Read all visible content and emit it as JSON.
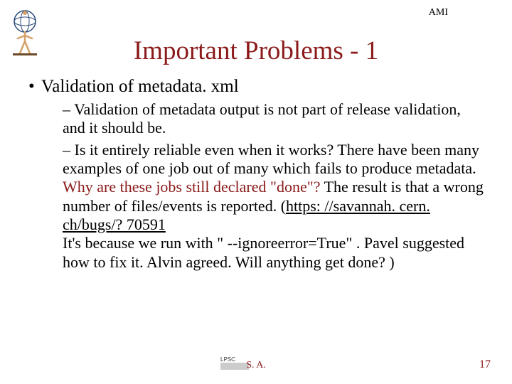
{
  "header_label": "AMI",
  "title": "Important Problems - 1",
  "bullet1": "Validation of metadata. xml",
  "sub1": "Validation of metadata output is not part of release validation, and it should be.",
  "sub2a": "Is it entirely reliable even when it works? There have been many examples of one job out of many which fails to produce metadata. ",
  "sub2_hl": "Why are these jobs still declared \"done\"?",
  "sub2b": " The result is that a wrong number of files/events is reported. (",
  "sub2_link": "https: //savannah. cern. ch/bugs/? 70591",
  "sub2_linebreak": "",
  "sub2c": "It's because we run with \" --ignoreerror=True\" . Pavel suggested how to fix it. Alvin agreed. Will anything get done? )",
  "footer_center": "S. A.",
  "footer_right": "17"
}
